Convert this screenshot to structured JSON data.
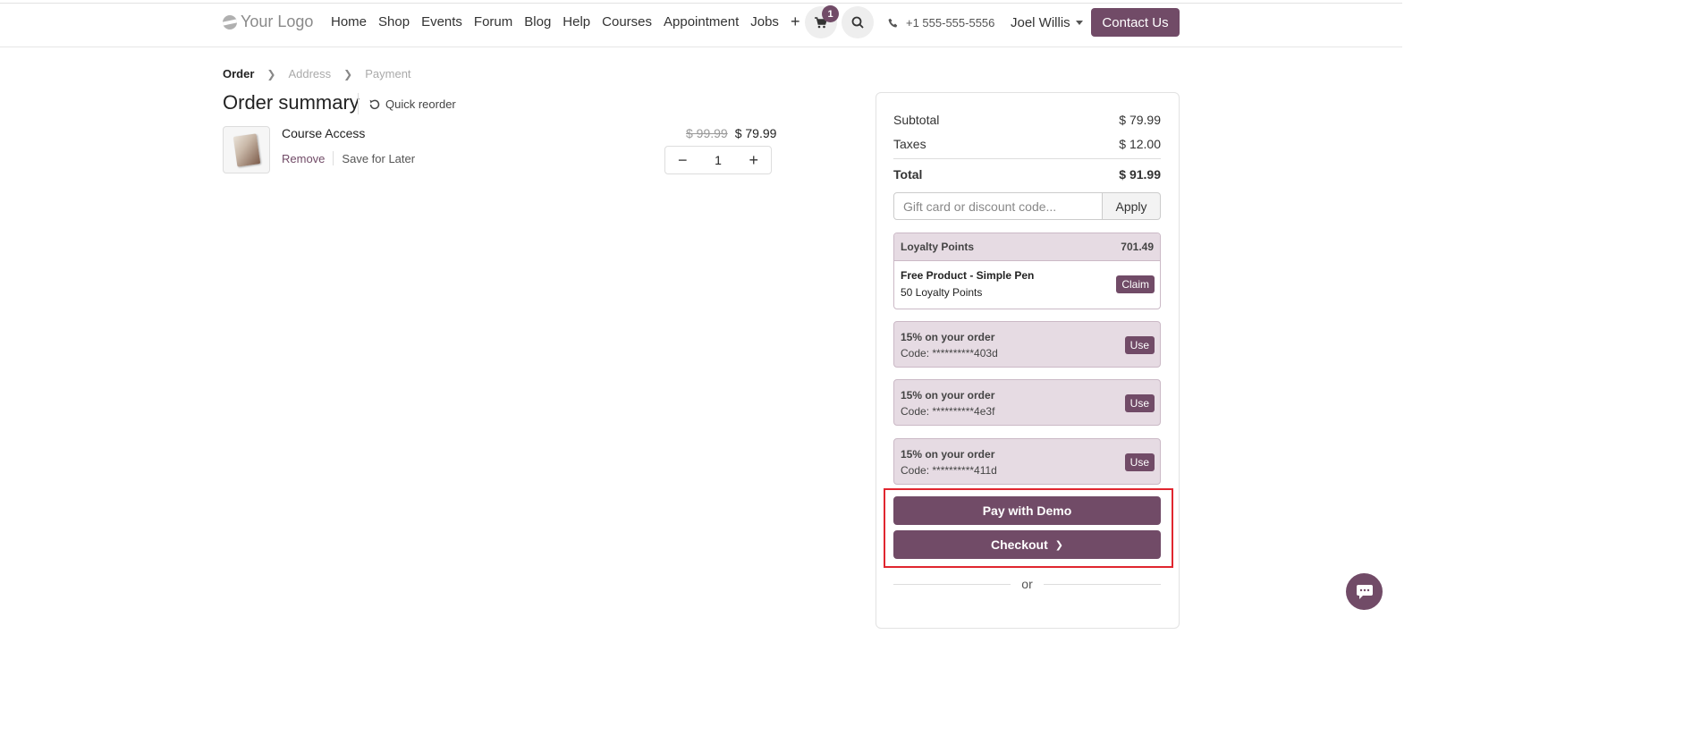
{
  "header": {
    "logo_text": "Your Logo",
    "nav": [
      "Home",
      "Shop",
      "Events",
      "Forum",
      "Blog",
      "Help",
      "Courses",
      "Appointment",
      "Jobs"
    ],
    "add_symbol": "+",
    "cart_count": "1",
    "phone": "+1 555-555-5556",
    "user_name": "Joel Willis",
    "contact_label": "Contact Us"
  },
  "breadcrumb": {
    "order": "Order",
    "address": "Address",
    "payment": "Payment"
  },
  "page": {
    "title": "Order summary",
    "quick_reorder": "Quick reorder"
  },
  "product": {
    "name": "Course Access",
    "remove": "Remove",
    "save_later": "Save for Later",
    "old_price": "$ 99.99",
    "price": "$ 79.99",
    "quantity": "1",
    "minus": "−",
    "plus": "+"
  },
  "summary": {
    "subtotal_label": "Subtotal",
    "subtotal_value": "$ 79.99",
    "taxes_label": "Taxes",
    "taxes_value": "$ 12.00",
    "total_label": "Total",
    "total_value": "$ 91.99",
    "coupon_placeholder": "Gift card or discount code...",
    "apply_label": "Apply"
  },
  "loyalty": {
    "title": "Loyalty Points",
    "points": "701.49",
    "reward_name": "Free Product - Simple Pen",
    "reward_cost": "50 Loyalty Points",
    "claim_label": "Claim"
  },
  "promos": [
    {
      "title": "15% on your order",
      "code": "Code: **********403d",
      "action": "Use"
    },
    {
      "title": "15% on your order",
      "code": "Code: **********4e3f",
      "action": "Use"
    },
    {
      "title": "15% on your order",
      "code": "Code: **********411d",
      "action": "Use"
    }
  ],
  "actions": {
    "pay_demo": "Pay with Demo",
    "checkout": "Checkout",
    "or": "or"
  },
  "colors": {
    "brand": "#714b67",
    "highlight": "#e0262f"
  }
}
